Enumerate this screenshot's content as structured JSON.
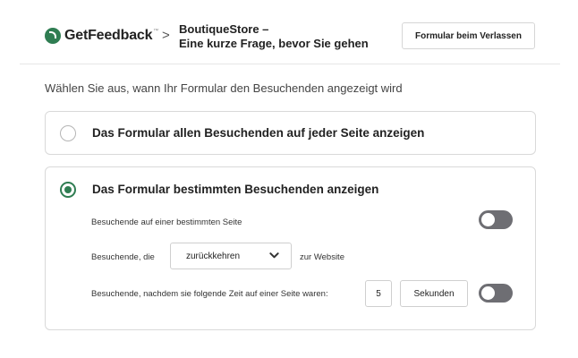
{
  "header": {
    "logo_text": "GetFeedback",
    "logo_tm": "™",
    "breadcrumb_separator": ">",
    "title_line1": "BoutiqueStore –",
    "title_line2": "Eine kurze Frage, bevor Sie gehen",
    "exit_form_button": "Formular beim Verlassen",
    "brand_color": "#2f7d52"
  },
  "main": {
    "heading": "Wählen Sie aus, wann Ihr Formular den Besuchenden angezeigt wird",
    "options": [
      {
        "label": "Das Formular allen Besuchenden auf jeder Seite anzeigen",
        "selected": false
      },
      {
        "label": "Das Formular bestimmten Besuchenden anzeigen",
        "selected": true
      }
    ],
    "rules": {
      "specific_page": {
        "label": "Besuchende auf einer bestimmten Seite",
        "enabled": false
      },
      "returning": {
        "prefix": "Besuchende, die",
        "select_value": "zurückkehren",
        "suffix": "zur Website"
      },
      "time_on_page": {
        "label": "Besuchende, nachdem sie folgende Zeit auf einer Seite waren:",
        "value": "5",
        "unit": "Sekunden",
        "enabled": false
      }
    }
  }
}
